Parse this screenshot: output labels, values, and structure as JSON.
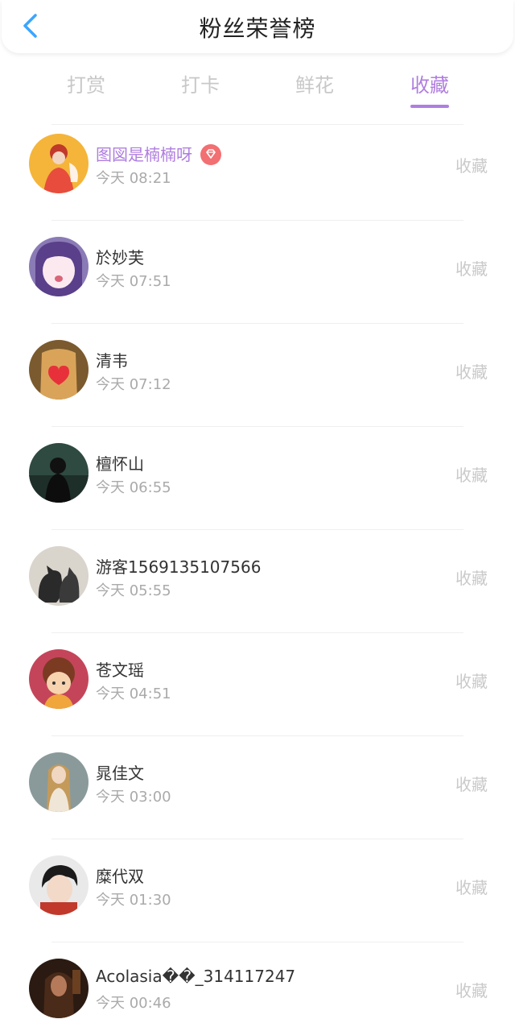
{
  "header": {
    "title": "粉丝荣誉榜",
    "back_icon": "chevron-left-icon",
    "accent": "#3aa6ff"
  },
  "tabs": [
    {
      "label": "打赏",
      "active": false
    },
    {
      "label": "打卡",
      "active": false
    },
    {
      "label": "鲜花",
      "active": false
    },
    {
      "label": "收藏",
      "active": true
    }
  ],
  "colors": {
    "active": "#b07ee0",
    "inactive": "#c8c8c8",
    "badge": "#f26f72"
  },
  "rows": [
    {
      "name": "图図是楠楠呀",
      "time": "今天 08:21",
      "action": "收藏",
      "vip": true,
      "badge_icon": "diamond-icon"
    },
    {
      "name": "於妙芙",
      "time": "今天 07:51",
      "action": "收藏"
    },
    {
      "name": "清韦",
      "time": "今天 07:12",
      "action": "收藏"
    },
    {
      "name": "檀怀山",
      "time": "今天 06:55",
      "action": "收藏"
    },
    {
      "name": "游客1569135107566",
      "time": "今天 05:55",
      "action": "收藏"
    },
    {
      "name": "苍文瑶",
      "time": "今天 04:51",
      "action": "收藏"
    },
    {
      "name": "晁佳文",
      "time": "今天 03:00",
      "action": "收藏"
    },
    {
      "name": "糜代双",
      "time": "今天 01:30",
      "action": "收藏"
    },
    {
      "name": "Acolasia��_314117247",
      "time": "今天 00:46",
      "action": "收藏"
    }
  ]
}
